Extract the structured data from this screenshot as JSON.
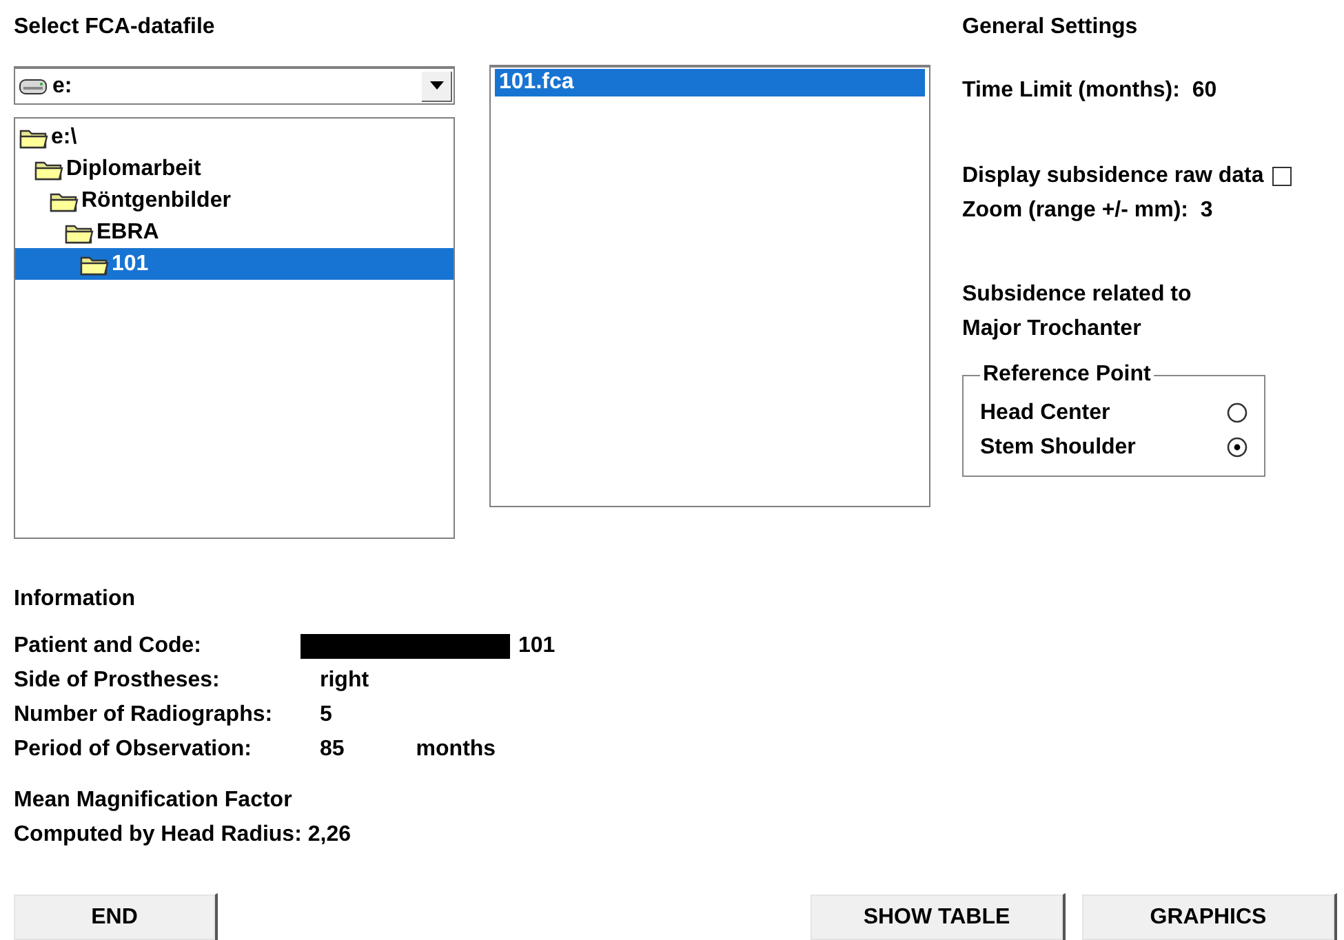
{
  "title": "Select FCA-datafile",
  "drive": {
    "value": "e:"
  },
  "folders": [
    {
      "label": "e:\\",
      "selected": false,
      "children": [
        {
          "label": "Diplomarbeit",
          "selected": false,
          "children": [
            {
              "label": "Röntgenbilder",
              "selected": false,
              "children": [
                {
                  "label": "EBRA",
                  "selected": false,
                  "children": [
                    {
                      "label": "101",
                      "selected": true
                    }
                  ]
                }
              ]
            }
          ]
        }
      ]
    }
  ],
  "files": [
    {
      "label": "101.fca",
      "selected": true
    }
  ],
  "settings": {
    "heading": "General Settings",
    "time_limit": {
      "label": "Time Limit (months):",
      "value": "60"
    },
    "raw_data": {
      "label": "Display subsidence raw data",
      "checked": false
    },
    "zoom": {
      "label": "Zoom (range +/- mm):",
      "value": "3"
    },
    "subsidence_lines": [
      "Subsidence related to",
      "Major Trochanter"
    ],
    "reference_point": {
      "legend": "Reference Point",
      "options": [
        {
          "label": "Head Center",
          "selected": false
        },
        {
          "label": "Stem Shoulder",
          "selected": true
        }
      ]
    }
  },
  "information": {
    "heading": "Information",
    "rows": [
      {
        "label": "Patient and Code:",
        "value": "101",
        "redacted": true
      },
      {
        "label": "Side of Prostheses:",
        "value": "right"
      },
      {
        "label": "Number of Radiographs:",
        "value": "5"
      },
      {
        "label": "Period of Observation:",
        "value": "85",
        "unit": "months"
      }
    ],
    "magnification": {
      "heading": "Mean Magnification Factor",
      "label": "Computed by Head Radius:",
      "value": "2,26"
    }
  },
  "buttons": {
    "left": [
      "END"
    ],
    "right": [
      "SHOW TABLE",
      "GRAPHICS"
    ]
  }
}
